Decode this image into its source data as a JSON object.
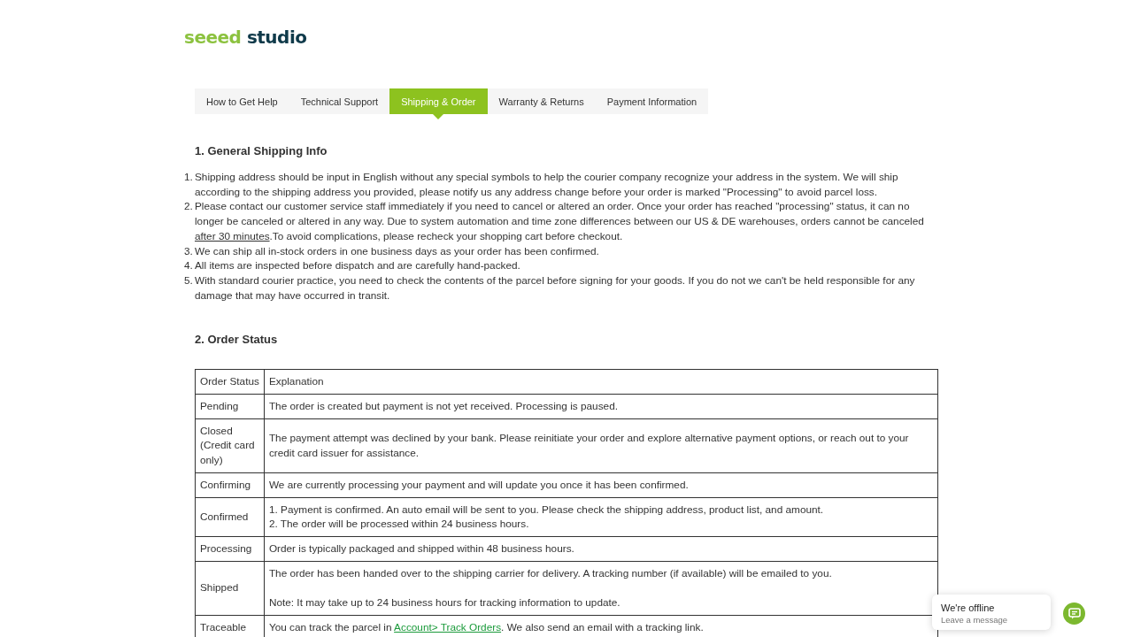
{
  "logo": {
    "part_1": "seeed",
    "part_2": "studio"
  },
  "tabs": [
    {
      "label": "How to Get Help",
      "selected": false
    },
    {
      "label": "Technical Support",
      "selected": false
    },
    {
      "label": "Shipping & Order",
      "selected": true
    },
    {
      "label": "Warranty & Returns",
      "selected": false
    },
    {
      "label": "Payment Information",
      "selected": false
    }
  ],
  "sections": [
    {
      "heading": "1. General Shipping Info",
      "items": [
        {
          "number": "1.",
          "segments": [
            {
              "kind": "text",
              "text": "Shipping address should be input in English without any special symbols to help the courier company recognize your address in the system. We will ship according to the shipping address you provided, please notify us any address change before your order is marked \"Processing\" to avoid parcel loss."
            }
          ]
        },
        {
          "number": "2.",
          "segments": [
            {
              "kind": "text",
              "text": "Please contact our customer service staff immediately if you need to cancel or altered an order. Once your order has reached \"processing\" status, it can no longer be canceled or altered in any way. Due to system automation and time zone differences between our US & DE warehouses, orders cannot be canceled "
            },
            {
              "kind": "underline",
              "text": "after 30 minutes"
            },
            {
              "kind": "text",
              "text": ".To avoid complications, please recheck your shopping cart before checkout."
            }
          ]
        },
        {
          "number": "3.",
          "segments": [
            {
              "kind": "text",
              "text": "We can ship all in-stock orders in one business days as your order has been confirmed."
            }
          ]
        },
        {
          "number": "4.",
          "segments": [
            {
              "kind": "text",
              "text": "All items are inspected before dispatch and are carefully hand-packed."
            }
          ]
        },
        {
          "number": "5.",
          "segments": [
            {
              "kind": "text",
              "text": "With standard courier practice, you need to check the contents of the parcel before signing for your goods. If you do not we can't be held responsible for any damage that may have occurred in transit."
            }
          ]
        }
      ]
    },
    {
      "heading": "2. Order Status"
    }
  ],
  "table": {
    "columns": [
      "Order Status",
      "Explanation"
    ],
    "rows": [
      {
        "status": "Pending",
        "explanation": [
          [
            {
              "kind": "text",
              "text": "The order is created but payment is not yet received. Processing is paused."
            }
          ]
        ]
      },
      {
        "status": "Closed (Credit card only)",
        "explanation": [
          [
            {
              "kind": "text",
              "text": "The payment attempt was declined by your bank. Please reinitiate your order and explore alternative payment options, or reach out to your credit card issuer for assistance."
            }
          ]
        ]
      },
      {
        "status": "Confirming",
        "explanation": [
          [
            {
              "kind": "text",
              "text": "We are currently processing your payment and will update you once it has been confirmed."
            }
          ]
        ]
      },
      {
        "status": "Confirmed",
        "explanation": [
          [
            {
              "kind": "text",
              "text": "1. Payment is confirmed. An auto email will be sent to you. Please check the shipping address, product list, and amount."
            }
          ],
          [
            {
              "kind": "text",
              "text": "2. The order will be processed within 24 business hours."
            }
          ]
        ]
      },
      {
        "status": "Processing",
        "explanation": [
          [
            {
              "kind": "text",
              "text": "Order is typically packaged and shipped within 48 business hours."
            }
          ]
        ]
      },
      {
        "status": "Shipped",
        "explanation": [
          [
            {
              "kind": "text",
              "text": "The order has been handed over to the shipping carrier for delivery. A tracking number (if available) will be emailed to you."
            }
          ],
          [
            {
              "kind": "gap"
            },
            {
              "kind": "text",
              "text": "Note: It may take up to 24 business hours for tracking information to update."
            }
          ]
        ]
      },
      {
        "status": "Traceable",
        "explanation": [
          [
            {
              "kind": "text",
              "text": "You can track the parcel in "
            },
            {
              "kind": "link",
              "text": "Account> Track Orders"
            },
            {
              "kind": "text",
              "text": ". We also send an email with a tracking link."
            }
          ]
        ]
      }
    ]
  },
  "chat": {
    "title": "We're offline",
    "subtitle": "Leave a message"
  }
}
